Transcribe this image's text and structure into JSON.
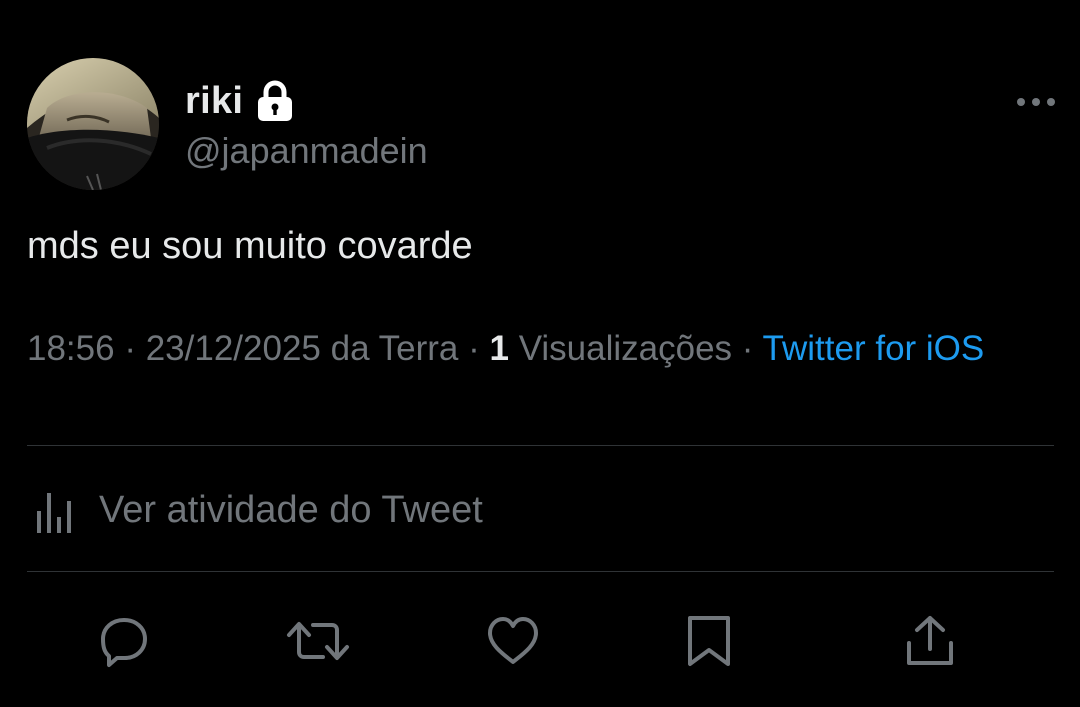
{
  "author": {
    "display_name": "riki",
    "handle": "@japanmadein",
    "protected": true,
    "avatar_icon": "profile-photo"
  },
  "tweet": {
    "text": "mds eu sou muito covarde"
  },
  "meta": {
    "time": "18:56",
    "separator": " · ",
    "date_location": "23/12/2025 da Terra",
    "views_count": "1",
    "views_label": "Visualizações",
    "source": "Twitter for iOS"
  },
  "activity": {
    "label": "Ver atividade do Tweet",
    "icon": "analytics-icon"
  },
  "actions": [
    {
      "name": "reply",
      "icon": "reply-icon"
    },
    {
      "name": "retweet",
      "icon": "retweet-icon"
    },
    {
      "name": "like",
      "icon": "heart-icon"
    },
    {
      "name": "bookmark",
      "icon": "bookmark-icon"
    },
    {
      "name": "share",
      "icon": "share-icon"
    }
  ],
  "colors": {
    "background": "#000000",
    "primary_text": "#e7e9ea",
    "secondary_text": "#71767b",
    "link": "#1d9bf0",
    "divider": "#2f3336"
  }
}
